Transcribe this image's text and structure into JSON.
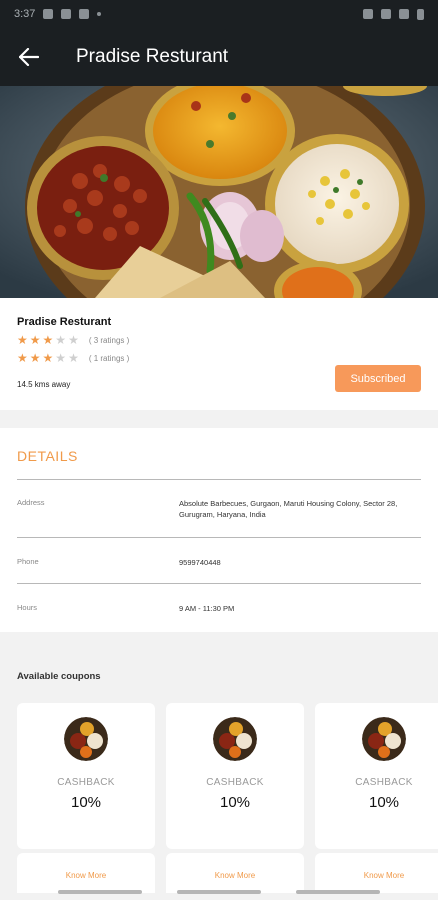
{
  "status_bar": {
    "time": "3:37"
  },
  "header": {
    "title": "Pradise Resturant"
  },
  "restaurant": {
    "name": "Pradise Resturant",
    "ratings": [
      {
        "stars": 3,
        "max": 5,
        "label": "( 3 ratings )"
      },
      {
        "stars": 3,
        "max": 5,
        "label": "( 1 ratings )"
      }
    ],
    "distance": "14.5 kms away",
    "subscribe_label": "Subscribed"
  },
  "colors": {
    "accent": "#f09a4a",
    "button": "#f7995a",
    "appbar": "#1b1f22"
  },
  "details": {
    "title": "DETAILS",
    "rows": [
      {
        "label": "Address",
        "value": "Absolute Barbecues, Gurgaon, Maruti Housing Colony, Sector 28, Gurugram, Haryana, India"
      },
      {
        "label": "Phone",
        "value": "9599740448"
      },
      {
        "label": "Hours",
        "value": "9 AM - 11:30 PM"
      }
    ]
  },
  "coupons": {
    "title": "Available coupons",
    "items": [
      {
        "type": "CASHBACK",
        "value": "10%",
        "link": "Know More"
      },
      {
        "type": "CASHBACK",
        "value": "10%",
        "link": "Know More"
      },
      {
        "type": "CASHBACK",
        "value": "10%",
        "link": "Know More"
      }
    ]
  }
}
